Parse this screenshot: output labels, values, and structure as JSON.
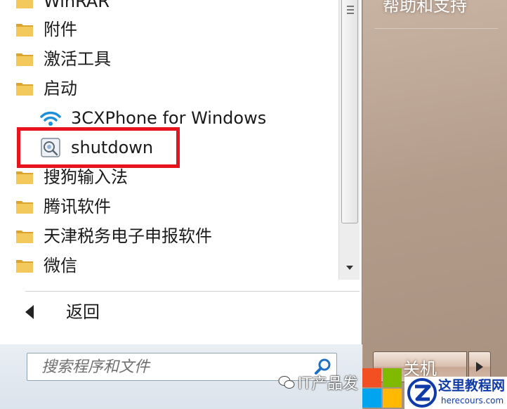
{
  "program_list": {
    "items": [
      {
        "label": "WinRAR",
        "type": "folder"
      },
      {
        "label": "附件",
        "type": "folder"
      },
      {
        "label": "激活工具",
        "type": "folder"
      },
      {
        "label": "启动",
        "type": "folder"
      },
      {
        "label": "3CXPhone for Windows",
        "type": "app",
        "icon": "wifi-icon"
      },
      {
        "label": "shutdown",
        "type": "app",
        "icon": "shutdown-shortcut-icon",
        "highlighted": true
      },
      {
        "label": "搜狗输入法",
        "type": "folder"
      },
      {
        "label": "腾讯软件",
        "type": "folder"
      },
      {
        "label": "天津税务电子申报软件",
        "type": "folder"
      },
      {
        "label": "微信",
        "type": "folder"
      }
    ]
  },
  "back": {
    "label": "返回"
  },
  "search": {
    "placeholder": "搜索程序和文件"
  },
  "right_panel": {
    "help_label": "帮助和支持",
    "shutdown_label": "关机"
  },
  "watermarks": {
    "wechat_text": "IT产品发",
    "site_name": "这里教程网",
    "site_url": "herecours.com"
  },
  "colors": {
    "highlight": "#e8141d",
    "folder": "#e9b93a",
    "accent_blue": "#1f8fd8"
  }
}
